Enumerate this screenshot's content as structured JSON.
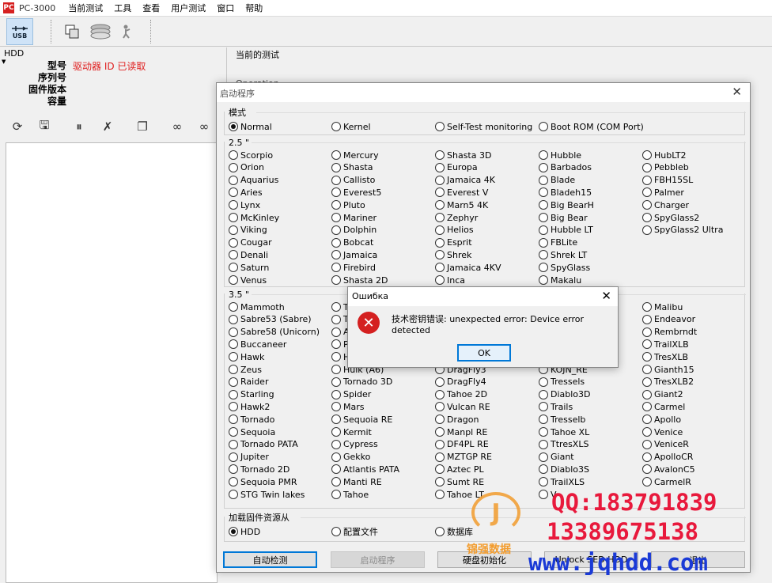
{
  "app": {
    "title": "PC-3000",
    "icon_text": "PC",
    "menu": [
      "当前测试",
      "工具",
      "查看",
      "用户测试",
      "窗口",
      "帮助"
    ]
  },
  "toolbar": {
    "usb_label": "USB"
  },
  "hdd_panel": {
    "title": "HDD",
    "labels": {
      "model": "型号",
      "serial": "序列号",
      "firmware": "固件版本",
      "capacity": "容量"
    },
    "status": "驱动器 ID 已读取"
  },
  "current_test": {
    "title": "当前的测试",
    "operation": "Operation"
  },
  "boot_dialog": {
    "title": "启动程序",
    "mode": {
      "label": "模式",
      "options": [
        "Normal",
        "Kernel",
        "Self-Test monitoring",
        "Boot ROM (COM Port)"
      ],
      "selected": "Normal"
    },
    "group_25": {
      "label": "2.5 \"",
      "columns": [
        [
          "Scorpio",
          "Orion",
          "Aquarius",
          "Aries",
          "Lynx",
          "McKinley",
          "Viking",
          "Cougar",
          "Denali",
          "Saturn",
          "Venus"
        ],
        [
          "Mercury",
          "Shasta",
          "Callisto",
          "Everest5",
          "Pluto",
          "Mariner",
          "Dolphin",
          "Bobcat",
          "Jamaica",
          "Firebird",
          "Shasta 2D"
        ],
        [
          "Shasta 3D",
          "Europa",
          "Jamaica 4K",
          "Everest V",
          "Marn5 4K",
          "Zephyr",
          "Helios",
          "Esprit",
          "Shrek",
          "Jamaica 4KV",
          "Inca"
        ],
        [
          "Hubble",
          "Barbados",
          "Blade",
          "Bladeh15",
          "Big BearH",
          "Big Bear",
          "Hubble LT",
          "FBLite",
          "Shrek LT",
          "SpyGlass",
          "Makalu"
        ],
        [
          "HubLT2",
          "Pebbleb",
          "FBH15SL",
          "Palmer",
          "Charger",
          "SpyGlass2",
          "SpyGlass2 Ultra"
        ]
      ]
    },
    "group_35": {
      "label": "3.5 \"",
      "columns": [
        [
          "Mammoth",
          "Sabre53 (Sabre)",
          "Sabre58 (Unicorn)",
          "Buccaneer",
          "Hawk",
          "Zeus",
          "Raider",
          "Starling",
          "Hawk2",
          "Tornado",
          "Sequoia",
          "Tornado PATA",
          "Jupiter",
          "Tornado 2D",
          "Sequoia PMR",
          "STG Twin lakes"
        ],
        [
          "T",
          "T",
          "A",
          "P",
          "H",
          "Hulk (A6)",
          "Tornado 3D",
          "Spider",
          "Mars",
          "Sequoia RE",
          "Kermit",
          "Cypress",
          "Gekko",
          "Atlantis PATA",
          "Manti RE",
          "Tahoe"
        ],
        [
          "",
          "",
          "",
          "",
          "",
          "DragFly3",
          "DragFly4",
          "Tahoe 2D",
          "Vulcan RE",
          "Dragon",
          "Manpl RE",
          "DF4PL RE",
          "MZTGP RE",
          "Aztec PL",
          "Sumt RE",
          "Tahoe LT"
        ],
        [
          "",
          "",
          "",
          "",
          "",
          "KOJN_RE",
          "Tressels",
          "Diablo3D",
          "Trails",
          "Tresselb",
          "Tahoe XL",
          "TtresXLS",
          "Giant",
          "Diablo3S",
          "TrailXLS",
          "V"
        ],
        [
          "Malibu",
          "Endeavor",
          "Rembrndt",
          "TrailXLB",
          "TresXLB",
          "Gianth15",
          "TresXLB2",
          "Giant2",
          "Carmel",
          "Apollo",
          "Venice",
          "VeniceR",
          "ApolloCR",
          "AvalonC5",
          "CarmelR",
          ""
        ]
      ]
    },
    "firmware_source": {
      "label": "加载固件资源从",
      "options": [
        "HDD",
        "配置文件",
        "数据库"
      ],
      "selected": "HDD"
    },
    "buttons": {
      "detect": "自动检测",
      "start": "启动程序",
      "init": "硬盘初始化",
      "unlock": "Unlock SED HDD",
      "exit": "退出"
    }
  },
  "error_dialog": {
    "title": "Ошибка",
    "message": "技术密钥错误: unexpected error: Device error detected",
    "ok": "OK"
  },
  "watermark": {
    "brand": "锦强数据",
    "qq": "QQ:183791839",
    "phone": "13389675138",
    "url": "www.jqhdd.com"
  },
  "colors": {
    "status_red": "#e02020",
    "watermark_red": "#e8193c",
    "watermark_blue": "#1a3ad6",
    "watermark_orange": "#f29c2e",
    "focus_blue": "#0078d7"
  }
}
